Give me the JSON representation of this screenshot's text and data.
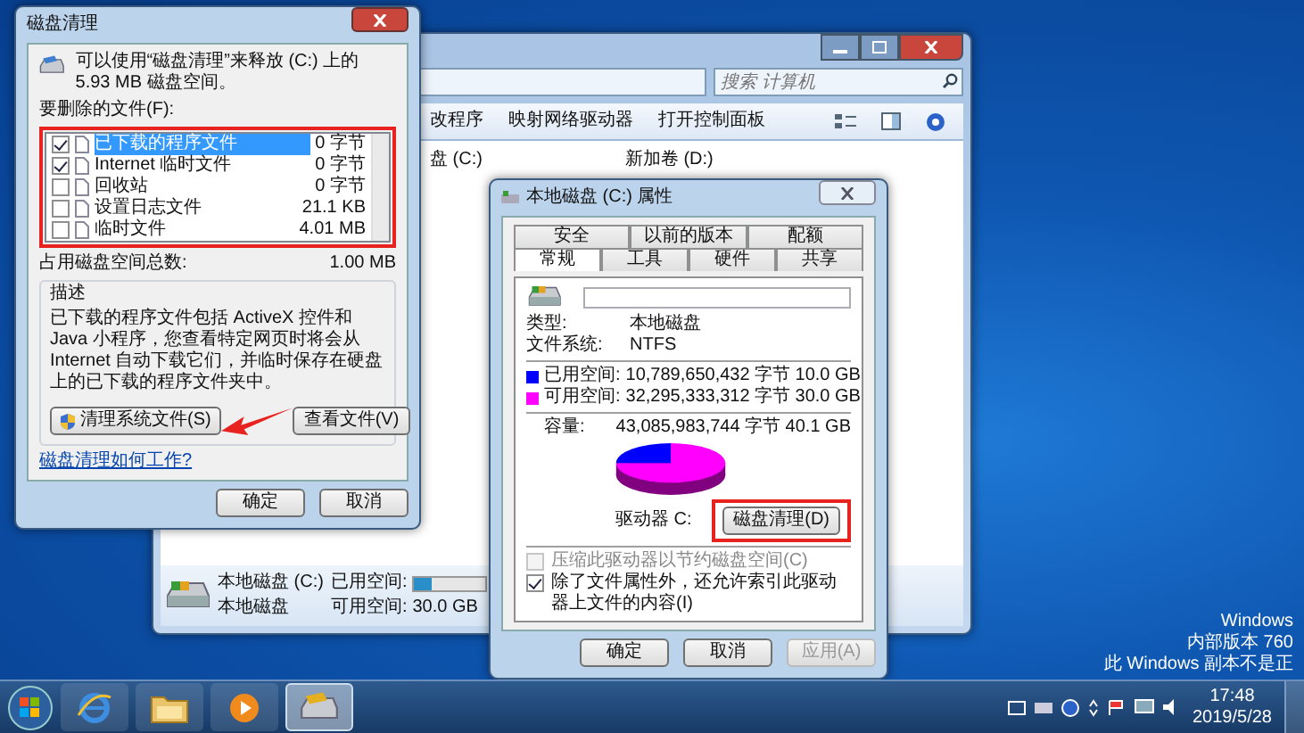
{
  "explorer": {
    "search": {
      "placeholder": "搜索 计算机"
    },
    "toolbar": [
      "改程序",
      "映射网络驱动器",
      "打开控制面板"
    ],
    "drives": [
      "盘 (C:)",
      "新加卷 (D:)"
    ],
    "details": {
      "name": "本地磁盘 (C:)",
      "type": "本地磁盘",
      "used_label": "已用空间:",
      "level": 0.25,
      "free_label": "可用空间:",
      "free": "30.0 GB"
    }
  },
  "cleanup": {
    "title": "磁盘清理",
    "intro": "可以使用“磁盘清理”来释放 (C:) 上的 5.93 MB 磁盘空间。",
    "list_label": "要删除的文件(F):",
    "files": [
      {
        "label": "已下载的程序文件",
        "size": "0 字节",
        "checked": true,
        "selected": true
      },
      {
        "label": "Internet 临时文件",
        "size": "0 字节",
        "checked": true,
        "selected": false
      },
      {
        "label": "回收站",
        "size": "0 字节",
        "checked": false,
        "selected": false
      },
      {
        "label": "设置日志文件",
        "size": "21.1 KB",
        "checked": false,
        "selected": false
      },
      {
        "label": "临时文件",
        "size": "4.01 MB",
        "checked": false,
        "selected": false
      }
    ],
    "total_label": "占用磁盘空间总数:",
    "total": "1.00 MB",
    "group_title": "描述",
    "description": "已下载的程序文件包括 ActiveX 控件和 Java 小程序，您查看特定网页时将会从 Internet 自动下载它们，并临时保存在硬盘上的已下载的程序文件夹中。",
    "system_button": "清理系统文件(S)",
    "view_button": "查看文件(V)",
    "link": "磁盘清理如何工作?",
    "ok": "确定",
    "cancel": "取消"
  },
  "properties": {
    "title": "本地磁盘 (C:) 属性",
    "tab_rows": [
      [
        {
          "label": "安全",
          "selected": false
        },
        {
          "label": "以前的版本",
          "selected": false
        },
        {
          "label": "配额",
          "selected": false
        }
      ],
      [
        {
          "label": "常规",
          "selected": true
        },
        {
          "label": "工具",
          "selected": false
        },
        {
          "label": "硬件",
          "selected": false
        },
        {
          "label": "共享",
          "selected": false
        }
      ]
    ],
    "info": [
      {
        "label": "类型:",
        "value": "本地磁盘"
      },
      {
        "label": "文件系统:",
        "value": "NTFS"
      }
    ],
    "space": [
      {
        "label": "已用空间:",
        "bytes": "10,789,650,432 字节",
        "size": "10.0 GB",
        "color": "#0000ff"
      },
      {
        "label": "可用空间:",
        "bytes": "32,295,333,312 字节",
        "size": "30.0 GB",
        "color": "#ff00ff"
      }
    ],
    "capacity": {
      "label": "容量:",
      "bytes": "43,085,983,744 字节",
      "size": "40.1 GB"
    },
    "drive_label": "驱动器 C:",
    "cleanup_button": "磁盘清理(D)",
    "options": [
      {
        "label": "压缩此驱动器以节约磁盘空间(C)",
        "checked": false,
        "disabled": true
      },
      {
        "label": "除了文件属性外，还允许索引此驱动器上文件的内容(I)",
        "checked": true,
        "disabled": false
      }
    ],
    "buttons": [
      {
        "label": "确定",
        "disabled": false
      },
      {
        "label": "取消",
        "disabled": false
      },
      {
        "label": "应用(A)",
        "disabled": true
      }
    ]
  },
  "taskbar": {
    "apps": [
      {
        "kind": "browser",
        "selected": false
      },
      {
        "kind": "folder",
        "selected": false
      },
      {
        "kind": "media",
        "selected": false
      },
      {
        "kind": "cleanup",
        "selected": true
      }
    ],
    "notice": [
      "Windows",
      "内部版本 760",
      "此 Windows 副本不是正"
    ],
    "time": "17:48",
    "date": "2019/5/28"
  }
}
